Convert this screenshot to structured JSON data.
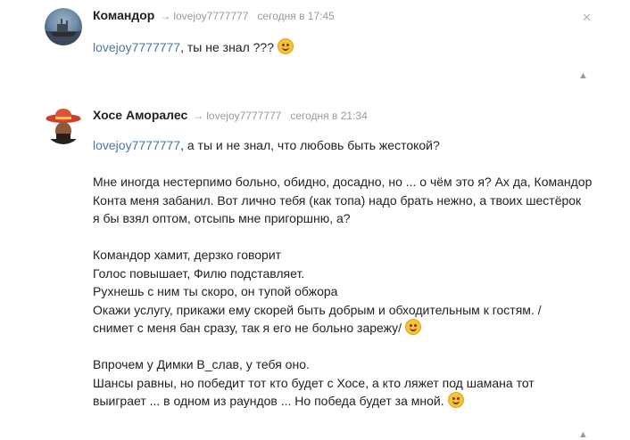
{
  "comments": [
    {
      "author": "Командор",
      "reply_arrow": "→",
      "reply_to": "lovejoy7777777",
      "date": "сегодня в 17:45",
      "mention": "lovejoy7777777",
      "text": ", ты не знал ???",
      "emoji": "smiling-face"
    },
    {
      "author": "Хосе Аморалес",
      "reply_arrow": "→",
      "reply_to": "lovejoy7777777",
      "date": "сегодня в 21:34",
      "mention": "lovejoy7777777",
      "first_line": ", а ты и не знал, что любовь быть жестокой?",
      "paragraph2": [
        "Мне иногда нестерпимо больно, обидно, досадно, но ... о чём это я? Ах да, Командор",
        "Конта меня забанил. Вот лично тебя (как топа) надо брать нежно, а твоих шестёрок",
        "я бы взял оптом, отсыпь мне пригоршню, а?"
      ],
      "paragraph3": [
        "Командор хамит, дерзко говорит",
        "Голос повышает, Филю подставляет.",
        "Рухнешь с ним ты скоро, он тупой обжора",
        "Окажи услугу, прикажи ему скорей быть добрым и обходительным к гостям. /",
        "снимет с меня бан сразу, так я его не больно зарежу/"
      ],
      "paragraph4": [
        "Впрочем у Димки В_слав, у тебя оно.",
        "Шансы равны, но победит тот кто будет с Хосе, а кто ляжет под шамана тот",
        "выиграет ... в одном из раундов ... Но победа будет за мной."
      ]
    }
  ],
  "icons": {
    "close": "✕",
    "up": "▲"
  }
}
